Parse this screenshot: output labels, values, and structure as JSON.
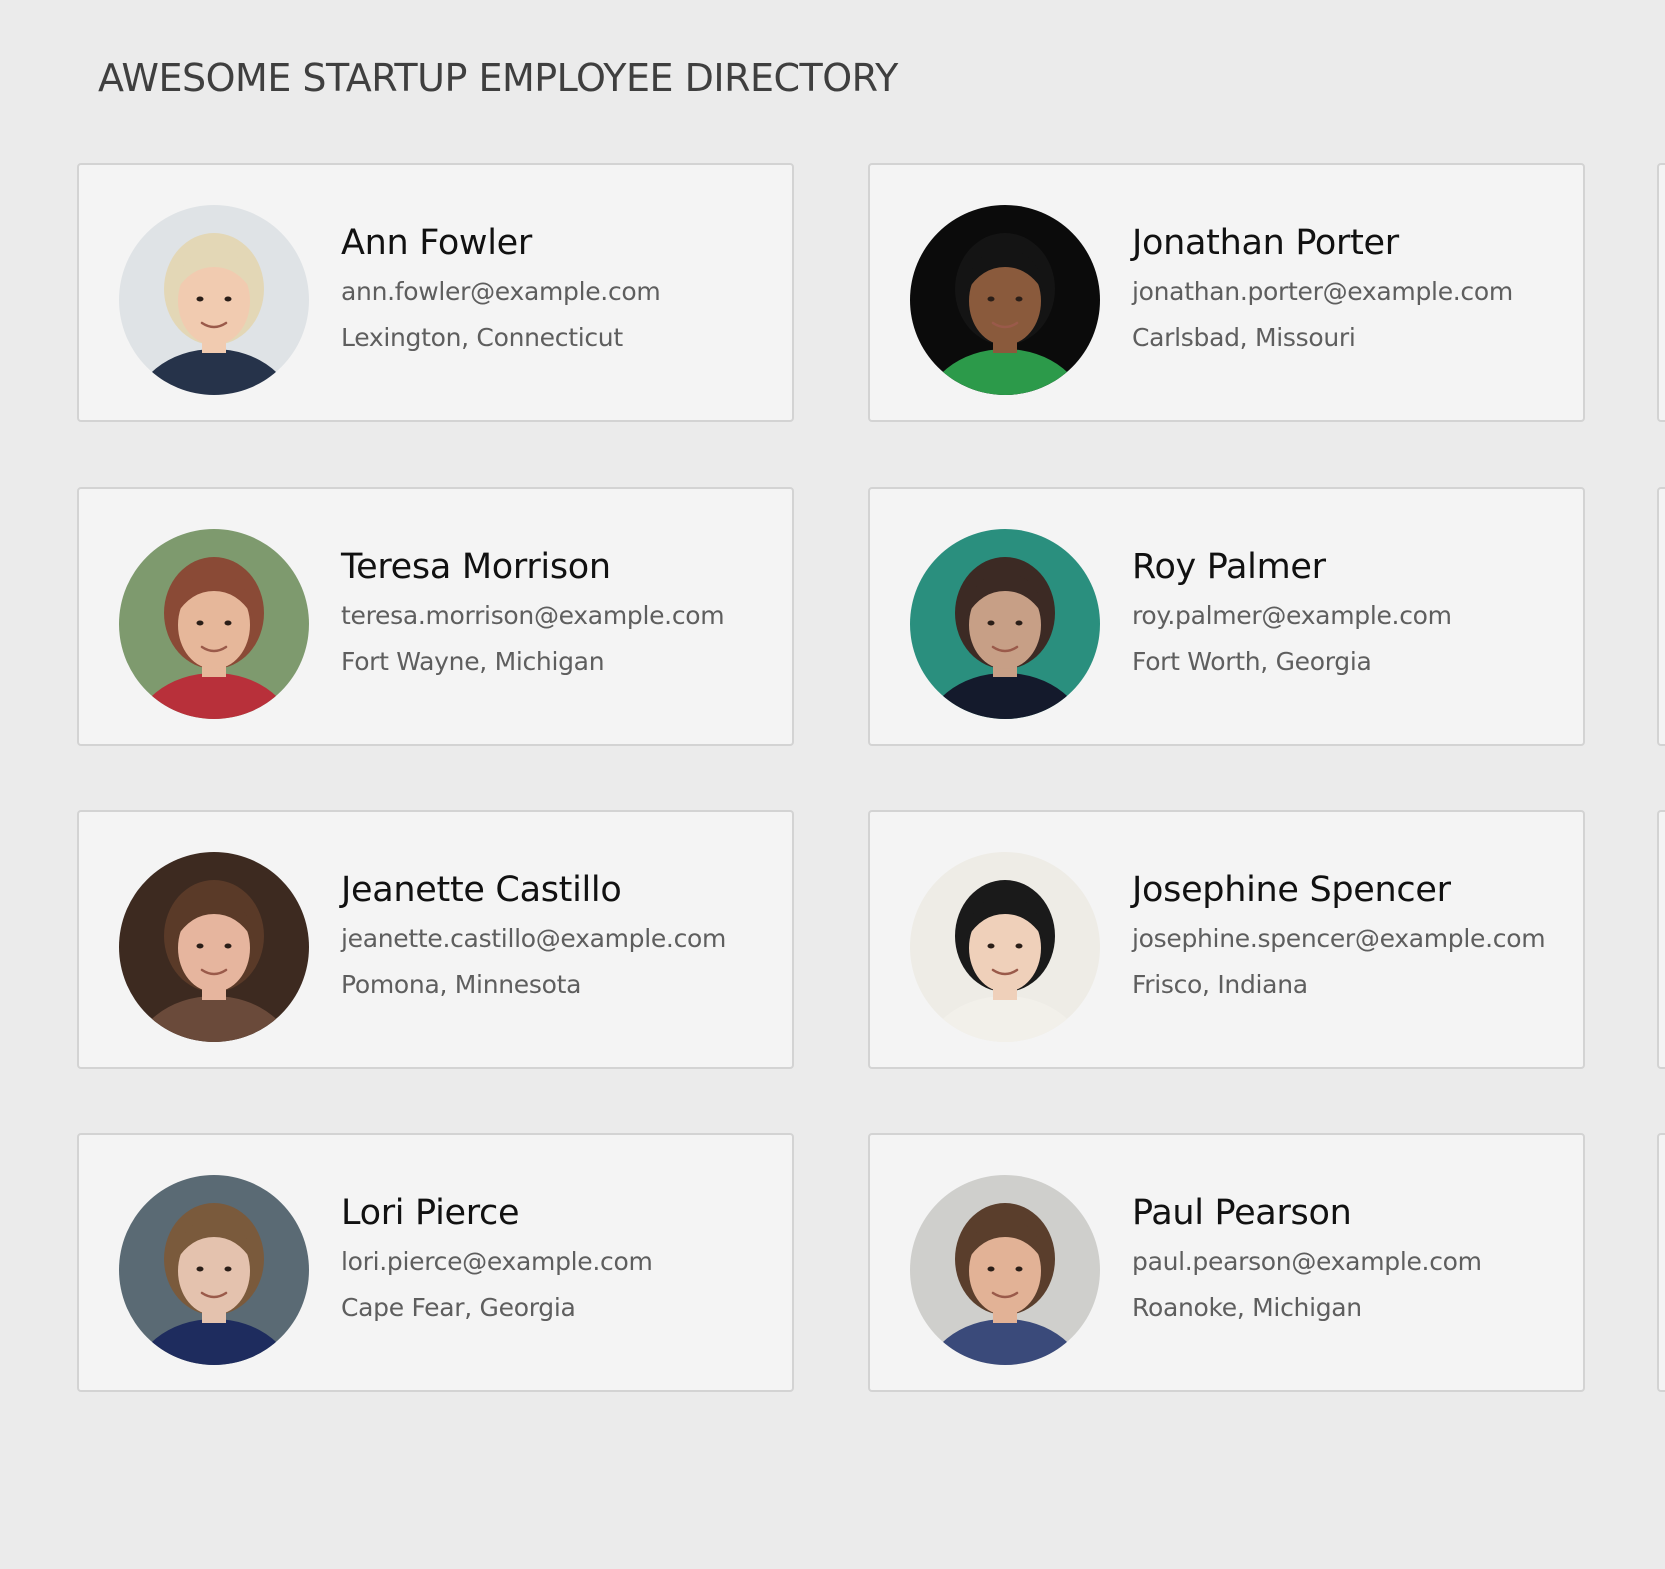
{
  "header": {
    "title": "AWESOME STARTUP EMPLOYEE DIRECTORY"
  },
  "employees": [
    {
      "name": "Ann Fowler",
      "email": "ann.fowler@example.com",
      "location": "Lexington, Connecticut",
      "avatar": {
        "bg": "#dfe3e6",
        "skin": "#f1cbb0",
        "hair": "#e3d7b6",
        "shirt": "#26334a"
      }
    },
    {
      "name": "Jonathan Porter",
      "email": "jonathan.porter@example.com",
      "location": "Carlsbad, Missouri",
      "avatar": {
        "bg": "#0b0b0b",
        "skin": "#8a5a3c",
        "hair": "#141414",
        "shirt": "#2c9a4a"
      }
    },
    {
      "name": "Teresa Morrison",
      "email": "teresa.morrison@example.com",
      "location": "Fort Wayne, Michigan",
      "avatar": {
        "bg": "#7e9a6e",
        "skin": "#e6b79a",
        "hair": "#8a4a36",
        "shirt": "#b8303a"
      }
    },
    {
      "name": "Roy Palmer",
      "email": "roy.palmer@example.com",
      "location": "Fort Worth, Georgia",
      "avatar": {
        "bg": "#2a8f7e",
        "skin": "#c79f86",
        "hair": "#3c2a24",
        "shirt": "#141a2c"
      }
    },
    {
      "name": "Jeanette Castillo",
      "email": "jeanette.castillo@example.com",
      "location": "Pomona, Minnesota",
      "avatar": {
        "bg": "#3d2a20",
        "skin": "#e6b59e",
        "hair": "#5a3a28",
        "shirt": "#6a4a3a"
      }
    },
    {
      "name": "Josephine Spencer",
      "email": "josephine.spencer@example.com",
      "location": "Frisco, Indiana",
      "avatar": {
        "bg": "#eeece6",
        "skin": "#efd0ba",
        "hair": "#1a1a1a",
        "shirt": "#f2f0ea"
      }
    },
    {
      "name": "Lori Pierce",
      "email": "lori.pierce@example.com",
      "location": "Cape Fear, Georgia",
      "avatar": {
        "bg": "#5a6a74",
        "skin": "#e4c2ae",
        "hair": "#7a5a3c",
        "shirt": "#1e2c5e"
      }
    },
    {
      "name": "Paul Pearson",
      "email": "paul.pearson@example.com",
      "location": "Roanoke, Michigan",
      "avatar": {
        "bg": "#cfcfcc",
        "skin": "#e2b296",
        "hair": "#5a3e2c",
        "shirt": "#3a4a7a"
      }
    }
  ]
}
